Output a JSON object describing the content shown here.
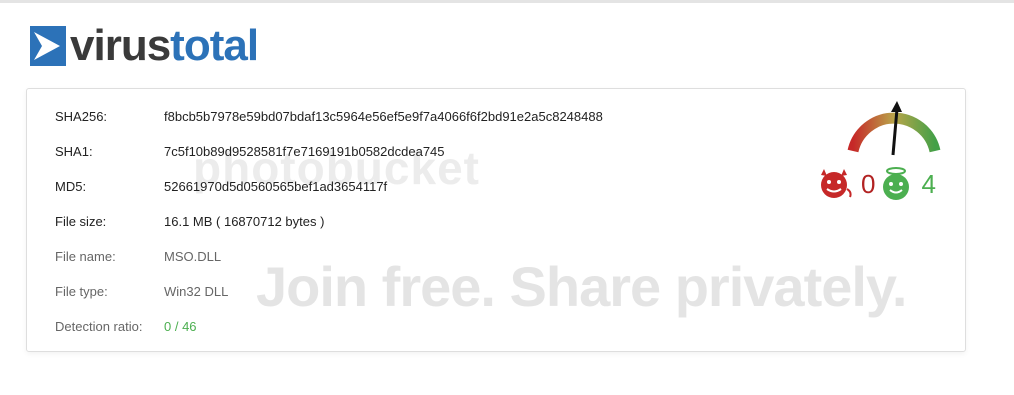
{
  "brand": {
    "name_part1": "virus",
    "name_part2": "total",
    "accent_color": "#2c72b8"
  },
  "file_info": [
    {
      "label": "SHA256:",
      "value": "f8bcb5b7978e59bd07bdaf13c5964e56ef5e9f7a4066f6f2bd91e2a5c8248488"
    },
    {
      "label": "SHA1:",
      "value": "7c5f10b89d9528581f7e7169191b0582dcdea745"
    },
    {
      "label": "MD5:",
      "value": "52661970d5d0560565bef1ad3654117f"
    },
    {
      "label": "File size:",
      "value": "16.1 MB ( 16870712 bytes )"
    },
    {
      "label": "File name:",
      "value": "MSO.DLL"
    },
    {
      "label": "File type:",
      "value": "Win32 DLL"
    },
    {
      "label": "Detection ratio:",
      "value": "0 / 46"
    }
  ],
  "scores": {
    "malicious": "0",
    "harmless": "4",
    "malicious_color": "#b22222",
    "harmless_color": "#4caf50"
  },
  "watermark": {
    "logo_text": "photobucket",
    "overlay_text": "Join free. Share privately."
  }
}
